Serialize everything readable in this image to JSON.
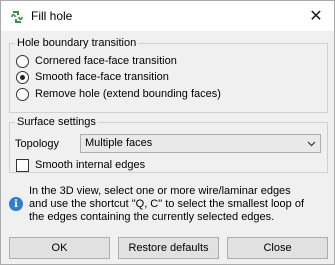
{
  "window": {
    "title": "Fill hole",
    "close_symbol": "✕",
    "icon": "fill-hole-app-icon",
    "icon_color": "#2e9b3a"
  },
  "hole_boundary": {
    "title": "Hole boundary transition",
    "options": [
      {
        "label": "Cornered face-face transition",
        "checked": false
      },
      {
        "label": "Smooth face-face transition",
        "checked": true
      },
      {
        "label": "Remove hole (extend bounding faces)",
        "checked": false
      }
    ]
  },
  "surface_settings": {
    "title": "Surface settings",
    "topology_label": "Topology",
    "topology_value": "Multiple faces",
    "smooth_internal_edges_label": "Smooth internal edges",
    "smooth_internal_edges_checked": false
  },
  "info": {
    "icon": "info-icon",
    "icon_glyph": "i",
    "color": "#2c7dd6",
    "text_lines": [
      "In the 3D view, select one or more wire/laminar edges",
      "and use the shortcut \"Q, C\" to select the smallest loop of",
      "the edges containing the currently selected edges."
    ]
  },
  "buttons": {
    "ok": "OK",
    "restore_defaults": "Restore defaults",
    "close": "Close"
  }
}
